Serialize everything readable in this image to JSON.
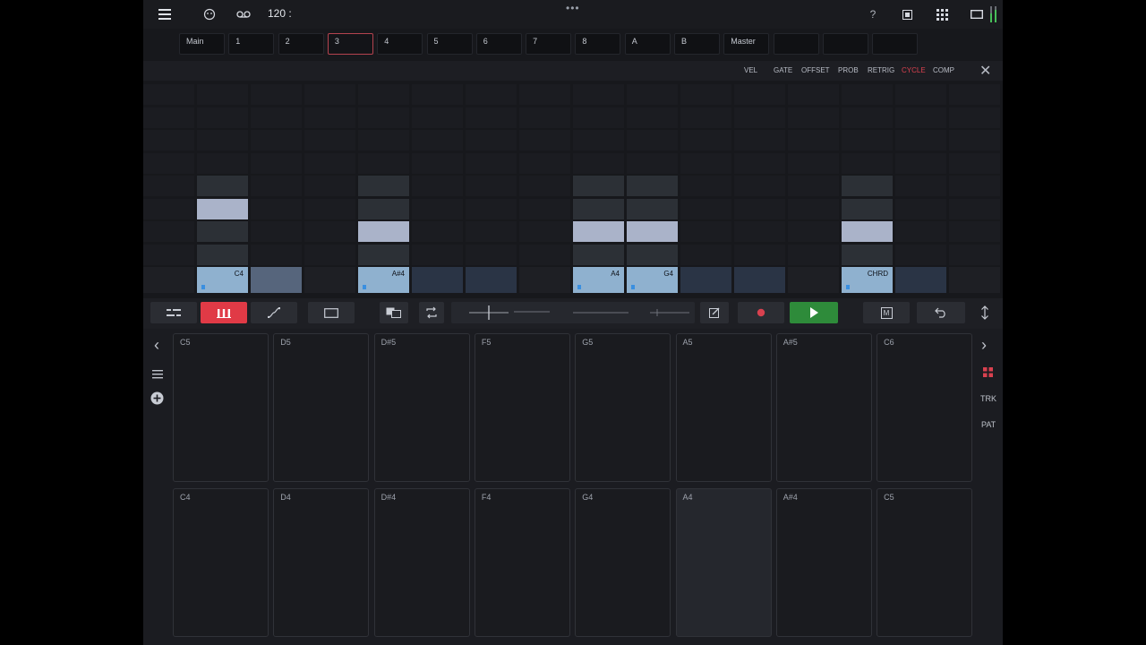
{
  "topbar": {
    "menu_icon": "hamburger-icon",
    "metronome_icon": "smiley-icon",
    "loop_icon": "cassette-icon",
    "tempo": "120",
    "tempo_suffix": ":",
    "grip": "•••",
    "help": "?",
    "window_icon": "square-icon",
    "grid_icon": "apps-grid-icon",
    "fullscreen_icon": "rectangle-icon",
    "meter_icon": "level-meter-icon"
  },
  "tracks": [
    {
      "label": "Main"
    },
    {
      "label": "1"
    },
    {
      "label": "2"
    },
    {
      "label": "3",
      "selected": true
    },
    {
      "label": "4"
    },
    {
      "label": "5"
    },
    {
      "label": "6"
    },
    {
      "label": "7"
    },
    {
      "label": "8"
    },
    {
      "label": "A"
    },
    {
      "label": "B"
    },
    {
      "label": "Master"
    },
    {
      "label": ""
    },
    {
      "label": ""
    },
    {
      "label": ""
    }
  ],
  "params": {
    "vel": "VEL",
    "gate": "GATE",
    "offset": "OFFSET",
    "prob": "PROB",
    "retrig": "RETRIG",
    "cycle": "CYCLE",
    "comp": "COMP",
    "close": "✕",
    "active": "cycle",
    "active_color": "#d8414f"
  },
  "steps": [
    {
      "label": "",
      "state": "empty"
    },
    {
      "label": "C4",
      "state": "note"
    },
    {
      "label": "",
      "state": "tied"
    },
    {
      "label": "",
      "state": "empty"
    },
    {
      "label": "A#4",
      "state": "note"
    },
    {
      "label": "",
      "state": "dim"
    },
    {
      "label": "",
      "state": "dim"
    },
    {
      "label": "",
      "state": "empty"
    },
    {
      "label": "A4",
      "state": "note"
    },
    {
      "label": "G4",
      "state": "note"
    },
    {
      "label": "",
      "state": "dim"
    },
    {
      "label": "",
      "state": "dim"
    },
    {
      "label": "",
      "state": "empty"
    },
    {
      "label": "CHRD",
      "state": "note"
    },
    {
      "label": "",
      "state": "dim"
    },
    {
      "label": "",
      "state": "empty"
    }
  ],
  "note_column_rows": {
    "1": {
      "note": 5,
      "context": [
        4,
        6,
        7
      ]
    },
    "4": {
      "note": 6,
      "context": [
        4,
        5,
        7
      ]
    },
    "8": {
      "note": 6,
      "context": [
        4,
        5,
        7
      ]
    },
    "9": {
      "note": 6,
      "context": [
        4,
        5,
        7
      ]
    },
    "13": {
      "note": 6,
      "context": [
        4,
        5,
        7
      ]
    }
  },
  "toolbar": {
    "record_color": "#d8414f",
    "play_color": "#2e8b3a",
    "mode_active_color": "#e03a46",
    "m_label": "M",
    "items": [
      "layout-icon",
      "step-bars-icon",
      "curve-icon",
      "rectangle-icon",
      "copy-icon",
      "loop-arrows-icon",
      "slider-icon",
      "edit-icon",
      "record-icon",
      "play-icon",
      "m-button",
      "undo-icon",
      "up-down-arrows-icon"
    ]
  },
  "pads": {
    "top": [
      "C5",
      "D5",
      "D#5",
      "F5",
      "G5",
      "A5",
      "A#5",
      "C6"
    ],
    "bottom": [
      "C4",
      "D4",
      "D#4",
      "F4",
      "G4",
      "A4",
      "A#4",
      "C5"
    ],
    "highlighted_bottom_index": 5
  },
  "side": {
    "left_prev": "‹",
    "left_list_icon": "list-icon",
    "left_add_icon": "plus-circle-icon",
    "right_next": "›",
    "right_grid_icon": "pads-icon",
    "trk": "TRK",
    "pat": "PAT"
  }
}
